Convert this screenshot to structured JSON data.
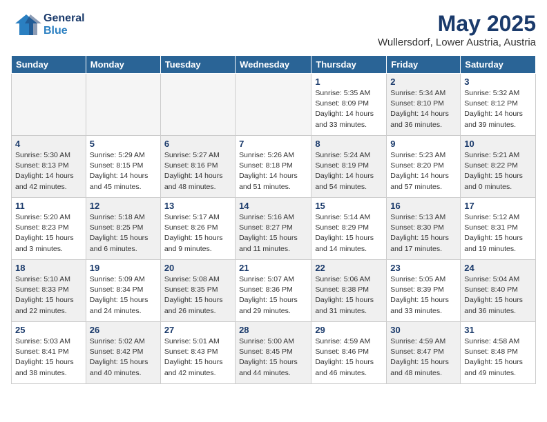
{
  "header": {
    "logo_general": "General",
    "logo_blue": "Blue",
    "title": "May 2025",
    "subtitle": "Wullersdorf, Lower Austria, Austria"
  },
  "weekdays": [
    "Sunday",
    "Monday",
    "Tuesday",
    "Wednesday",
    "Thursday",
    "Friday",
    "Saturday"
  ],
  "weeks": [
    [
      {
        "day": "",
        "info": "",
        "empty": true
      },
      {
        "day": "",
        "info": "",
        "empty": true
      },
      {
        "day": "",
        "info": "",
        "empty": true
      },
      {
        "day": "",
        "info": "",
        "empty": true
      },
      {
        "day": "1",
        "info": "Sunrise: 5:35 AM\nSunset: 8:09 PM\nDaylight: 14 hours\nand 33 minutes.",
        "empty": false
      },
      {
        "day": "2",
        "info": "Sunrise: 5:34 AM\nSunset: 8:10 PM\nDaylight: 14 hours\nand 36 minutes.",
        "empty": false
      },
      {
        "day": "3",
        "info": "Sunrise: 5:32 AM\nSunset: 8:12 PM\nDaylight: 14 hours\nand 39 minutes.",
        "empty": false
      }
    ],
    [
      {
        "day": "4",
        "info": "Sunrise: 5:30 AM\nSunset: 8:13 PM\nDaylight: 14 hours\nand 42 minutes.",
        "empty": false
      },
      {
        "day": "5",
        "info": "Sunrise: 5:29 AM\nSunset: 8:15 PM\nDaylight: 14 hours\nand 45 minutes.",
        "empty": false
      },
      {
        "day": "6",
        "info": "Sunrise: 5:27 AM\nSunset: 8:16 PM\nDaylight: 14 hours\nand 48 minutes.",
        "empty": false
      },
      {
        "day": "7",
        "info": "Sunrise: 5:26 AM\nSunset: 8:18 PM\nDaylight: 14 hours\nand 51 minutes.",
        "empty": false
      },
      {
        "day": "8",
        "info": "Sunrise: 5:24 AM\nSunset: 8:19 PM\nDaylight: 14 hours\nand 54 minutes.",
        "empty": false
      },
      {
        "day": "9",
        "info": "Sunrise: 5:23 AM\nSunset: 8:20 PM\nDaylight: 14 hours\nand 57 minutes.",
        "empty": false
      },
      {
        "day": "10",
        "info": "Sunrise: 5:21 AM\nSunset: 8:22 PM\nDaylight: 15 hours\nand 0 minutes.",
        "empty": false
      }
    ],
    [
      {
        "day": "11",
        "info": "Sunrise: 5:20 AM\nSunset: 8:23 PM\nDaylight: 15 hours\nand 3 minutes.",
        "empty": false
      },
      {
        "day": "12",
        "info": "Sunrise: 5:18 AM\nSunset: 8:25 PM\nDaylight: 15 hours\nand 6 minutes.",
        "empty": false
      },
      {
        "day": "13",
        "info": "Sunrise: 5:17 AM\nSunset: 8:26 PM\nDaylight: 15 hours\nand 9 minutes.",
        "empty": false
      },
      {
        "day": "14",
        "info": "Sunrise: 5:16 AM\nSunset: 8:27 PM\nDaylight: 15 hours\nand 11 minutes.",
        "empty": false
      },
      {
        "day": "15",
        "info": "Sunrise: 5:14 AM\nSunset: 8:29 PM\nDaylight: 15 hours\nand 14 minutes.",
        "empty": false
      },
      {
        "day": "16",
        "info": "Sunrise: 5:13 AM\nSunset: 8:30 PM\nDaylight: 15 hours\nand 17 minutes.",
        "empty": false
      },
      {
        "day": "17",
        "info": "Sunrise: 5:12 AM\nSunset: 8:31 PM\nDaylight: 15 hours\nand 19 minutes.",
        "empty": false
      }
    ],
    [
      {
        "day": "18",
        "info": "Sunrise: 5:10 AM\nSunset: 8:33 PM\nDaylight: 15 hours\nand 22 minutes.",
        "empty": false
      },
      {
        "day": "19",
        "info": "Sunrise: 5:09 AM\nSunset: 8:34 PM\nDaylight: 15 hours\nand 24 minutes.",
        "empty": false
      },
      {
        "day": "20",
        "info": "Sunrise: 5:08 AM\nSunset: 8:35 PM\nDaylight: 15 hours\nand 26 minutes.",
        "empty": false
      },
      {
        "day": "21",
        "info": "Sunrise: 5:07 AM\nSunset: 8:36 PM\nDaylight: 15 hours\nand 29 minutes.",
        "empty": false
      },
      {
        "day": "22",
        "info": "Sunrise: 5:06 AM\nSunset: 8:38 PM\nDaylight: 15 hours\nand 31 minutes.",
        "empty": false
      },
      {
        "day": "23",
        "info": "Sunrise: 5:05 AM\nSunset: 8:39 PM\nDaylight: 15 hours\nand 33 minutes.",
        "empty": false
      },
      {
        "day": "24",
        "info": "Sunrise: 5:04 AM\nSunset: 8:40 PM\nDaylight: 15 hours\nand 36 minutes.",
        "empty": false
      }
    ],
    [
      {
        "day": "25",
        "info": "Sunrise: 5:03 AM\nSunset: 8:41 PM\nDaylight: 15 hours\nand 38 minutes.",
        "empty": false
      },
      {
        "day": "26",
        "info": "Sunrise: 5:02 AM\nSunset: 8:42 PM\nDaylight: 15 hours\nand 40 minutes.",
        "empty": false
      },
      {
        "day": "27",
        "info": "Sunrise: 5:01 AM\nSunset: 8:43 PM\nDaylight: 15 hours\nand 42 minutes.",
        "empty": false
      },
      {
        "day": "28",
        "info": "Sunrise: 5:00 AM\nSunset: 8:45 PM\nDaylight: 15 hours\nand 44 minutes.",
        "empty": false
      },
      {
        "day": "29",
        "info": "Sunrise: 4:59 AM\nSunset: 8:46 PM\nDaylight: 15 hours\nand 46 minutes.",
        "empty": false
      },
      {
        "day": "30",
        "info": "Sunrise: 4:59 AM\nSunset: 8:47 PM\nDaylight: 15 hours\nand 48 minutes.",
        "empty": false
      },
      {
        "day": "31",
        "info": "Sunrise: 4:58 AM\nSunset: 8:48 PM\nDaylight: 15 hours\nand 49 minutes.",
        "empty": false
      }
    ]
  ]
}
